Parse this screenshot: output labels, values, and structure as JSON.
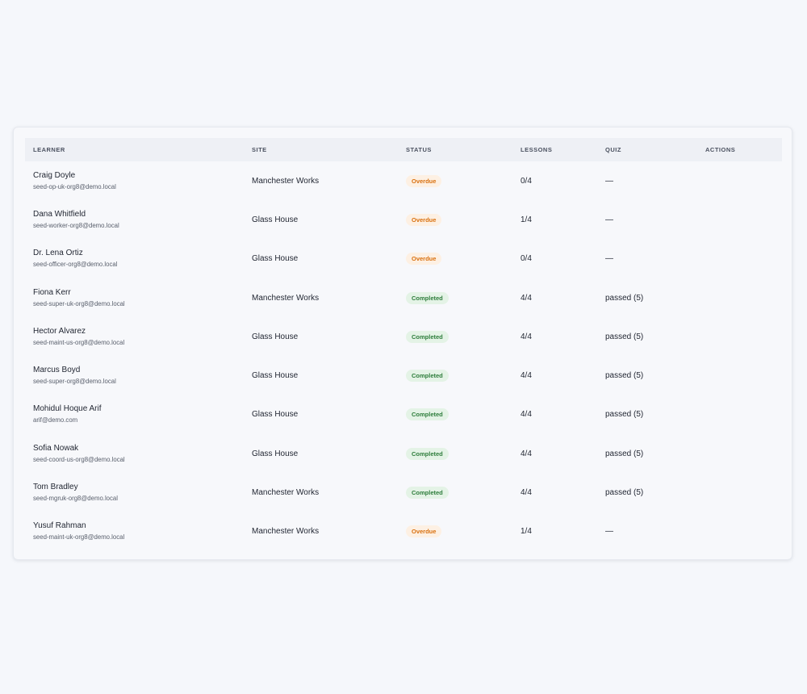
{
  "table": {
    "headers": {
      "learner": "LEARNER",
      "site": "SITE",
      "status": "STATUS",
      "lessons": "LESSONS",
      "quiz": "QUIZ",
      "actions": "ACTIONS"
    },
    "rows": [
      {
        "name": "Craig Doyle",
        "email": "seed-op-uk-org8@demo.local",
        "site": "Manchester Works",
        "status": "Overdue",
        "lessons": "0/4",
        "quiz": "—"
      },
      {
        "name": "Dana Whitfield",
        "email": "seed-worker-org8@demo.local",
        "site": "Glass House",
        "status": "Overdue",
        "lessons": "1/4",
        "quiz": "—"
      },
      {
        "name": "Dr. Lena Ortiz",
        "email": "seed-officer-org8@demo.local",
        "site": "Glass House",
        "status": "Overdue",
        "lessons": "0/4",
        "quiz": "—"
      },
      {
        "name": "Fiona Kerr",
        "email": "seed-super-uk-org8@demo.local",
        "site": "Manchester Works",
        "status": "Completed",
        "lessons": "4/4",
        "quiz": "passed (5)"
      },
      {
        "name": "Hector Alvarez",
        "email": "seed-maint-us-org8@demo.local",
        "site": "Glass House",
        "status": "Completed",
        "lessons": "4/4",
        "quiz": "passed (5)"
      },
      {
        "name": "Marcus Boyd",
        "email": "seed-super-org8@demo.local",
        "site": "Glass House",
        "status": "Completed",
        "lessons": "4/4",
        "quiz": "passed (5)"
      },
      {
        "name": "Mohidul Hoque Arif",
        "email": "arif@demo.com",
        "site": "Glass House",
        "status": "Completed",
        "lessons": "4/4",
        "quiz": "passed (5)"
      },
      {
        "name": "Sofia Nowak",
        "email": "seed-coord-us-org8@demo.local",
        "site": "Glass House",
        "status": "Completed",
        "lessons": "4/4",
        "quiz": "passed (5)"
      },
      {
        "name": "Tom Bradley",
        "email": "seed-mgruk-org8@demo.local",
        "site": "Manchester Works",
        "status": "Completed",
        "lessons": "4/4",
        "quiz": "passed (5)"
      },
      {
        "name": "Yusuf Rahman",
        "email": "seed-maint-uk-org8@demo.local",
        "site": "Manchester Works",
        "status": "Overdue",
        "lessons": "1/4",
        "quiz": "—"
      }
    ]
  },
  "colors": {
    "overdue": "#d9700f",
    "completed": "#2e7d3c"
  }
}
